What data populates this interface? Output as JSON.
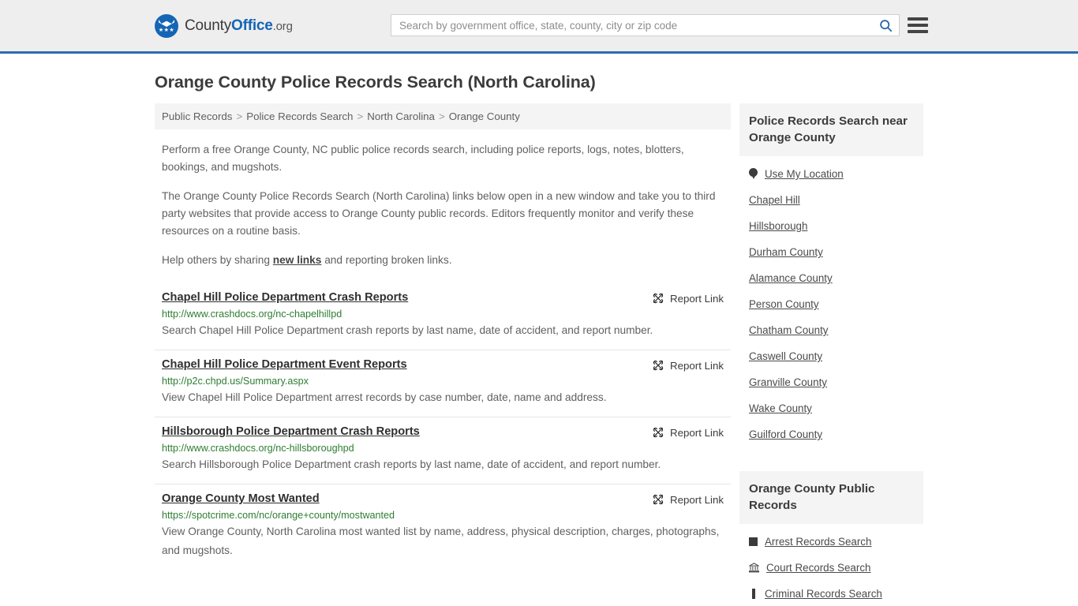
{
  "header": {
    "brand": {
      "county": "County",
      "office": "Office",
      "org": ".org",
      "stars": "★★★"
    },
    "search": {
      "placeholder": "Search by government office, state, county, city or zip code",
      "value": "",
      "search_icon": "search-icon"
    },
    "menu_icon": "hamburger-menu-icon"
  },
  "page": {
    "title": "Orange County Police Records Search (North Carolina)"
  },
  "breadcrumb": {
    "items": [
      "Public Records",
      "Police Records Search",
      "North Carolina",
      "Orange County"
    ],
    "separator": ">"
  },
  "intro": {
    "p1": "Perform a free Orange County, NC public police records search, including police reports, logs, notes, blotters, bookings, and mugshots.",
    "p2": "The Orange County Police Records Search (North Carolina) links below open in a new window and take you to third party websites that provide access to Orange County public records. Editors frequently monitor and verify these resources on a routine basis.",
    "p3_before": "Help others by sharing ",
    "p3_link": "new links",
    "p3_after": " and reporting broken links."
  },
  "results": {
    "report_label": "Report Link",
    "report_icon": "broken-link-icon",
    "items": [
      {
        "title": "Chapel Hill Police Department Crash Reports",
        "url": "http://www.crashdocs.org/nc-chapelhillpd",
        "desc": "Search Chapel Hill Police Department crash reports by last name, date of accident, and report number."
      },
      {
        "title": "Chapel Hill Police Department Event Reports",
        "url": "http://p2c.chpd.us/Summary.aspx",
        "desc": "View Chapel Hill Police Department arrest records by case number, date, name and address."
      },
      {
        "title": "Hillsborough Police Department Crash Reports",
        "url": "http://www.crashdocs.org/nc-hillsboroughpd",
        "desc": "Search Hillsborough Police Department crash reports by last name, date of accident, and report number."
      },
      {
        "title": "Orange County Most Wanted",
        "url": "https://spotcrime.com/nc/orange+county/mostwanted",
        "desc": "View Orange County, North Carolina most wanted list by name, address, physical description, charges, photographs, and mugshots."
      }
    ]
  },
  "sidebar": {
    "nearby": {
      "title": "Police Records Search near Orange County",
      "items": [
        {
          "label": "Use My Location",
          "icon": "map-pin-icon"
        },
        {
          "label": "Chapel Hill",
          "icon": ""
        },
        {
          "label": "Hillsborough",
          "icon": ""
        },
        {
          "label": "Durham County",
          "icon": ""
        },
        {
          "label": "Alamance County",
          "icon": ""
        },
        {
          "label": "Person County",
          "icon": ""
        },
        {
          "label": "Chatham County",
          "icon": ""
        },
        {
          "label": "Caswell County",
          "icon": ""
        },
        {
          "label": "Granville County",
          "icon": ""
        },
        {
          "label": "Wake County",
          "icon": ""
        },
        {
          "label": "Guilford County",
          "icon": ""
        }
      ]
    },
    "public_records": {
      "title": "Orange County Public Records",
      "items": [
        {
          "label": "Arrest Records Search",
          "icon": "fingerprint-card-icon"
        },
        {
          "label": "Court Records Search",
          "icon": "courthouse-icon"
        },
        {
          "label": "Criminal Records Search",
          "icon": "document-icon"
        }
      ]
    }
  },
  "colors": {
    "brand_blue": "#1565b5",
    "header_bg": "#eeeeee",
    "header_border": "#2b6cb0",
    "url_green": "#2e7d32",
    "panel_bg": "#f4f4f4"
  }
}
